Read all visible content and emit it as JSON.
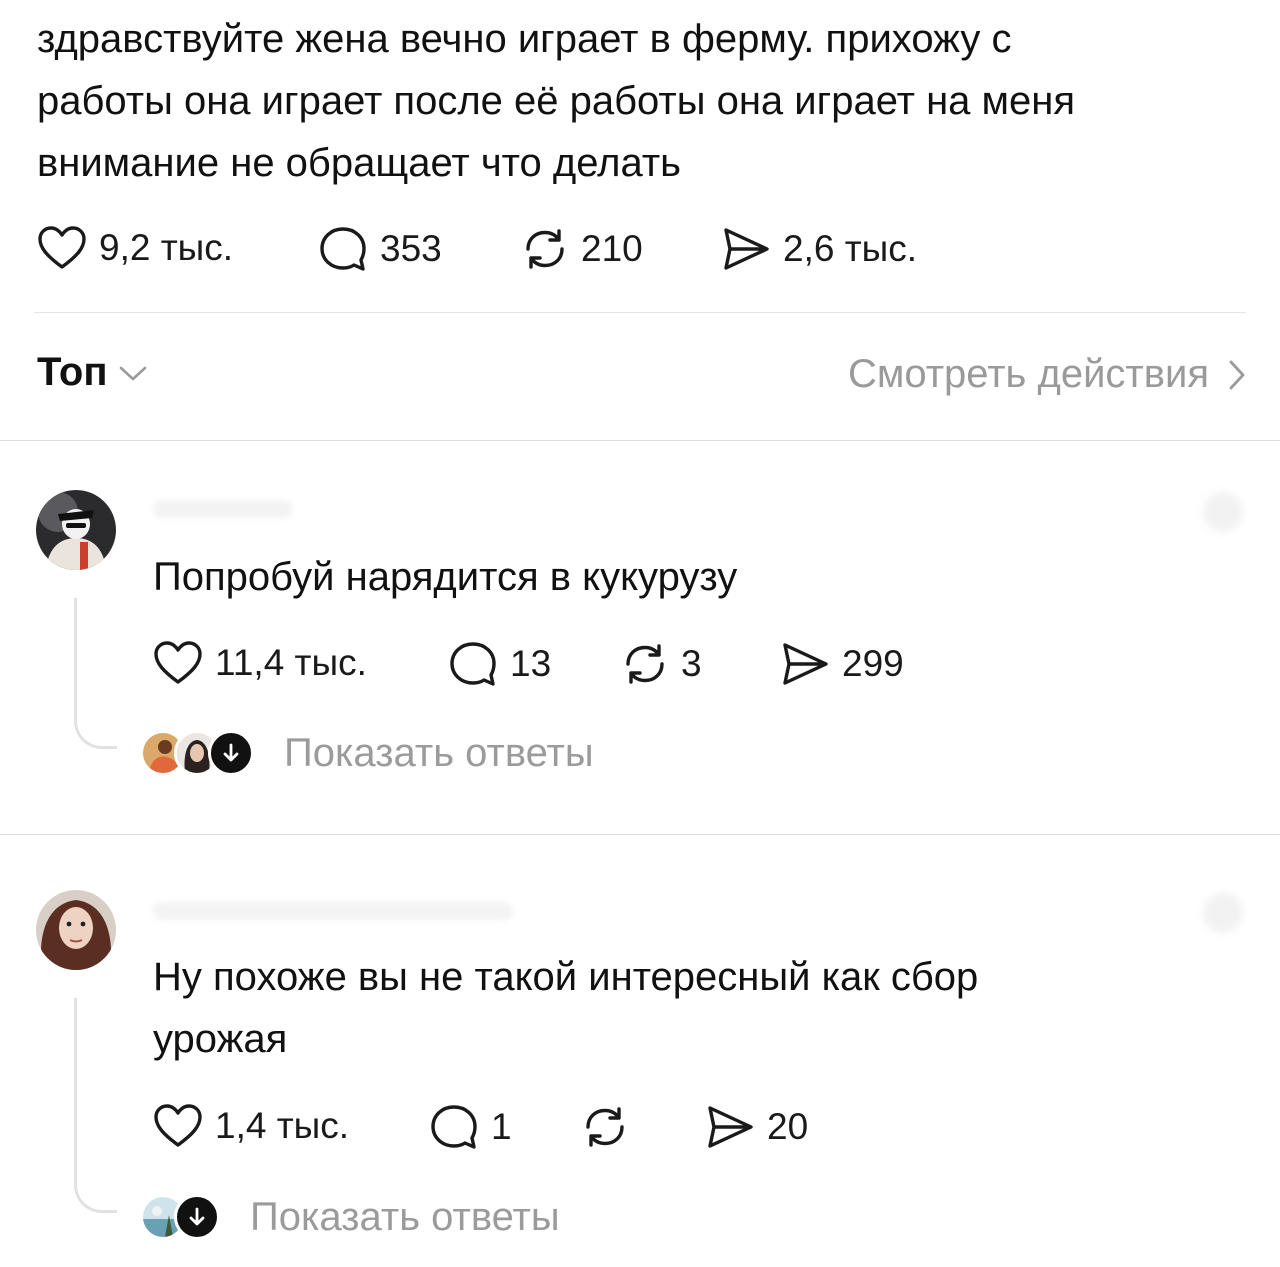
{
  "post": {
    "text_lines": [
      "здравствуйте жена вечно играет в ферму. прихожу с",
      "работы она играет после её работы она играет на меня",
      "внимание не обращает что делать"
    ],
    "stats": {
      "likes": "9,2 тыс.",
      "comments": "353",
      "reposts": "210",
      "shares": "2,6 тыс."
    }
  },
  "sort": {
    "label": "Топ",
    "activity_label": "Смотреть действия"
  },
  "comments": [
    {
      "text": "Попробуй нарядится в кукурузу",
      "stats": {
        "likes": "11,4 тыс.",
        "comments": "13",
        "reposts": "3",
        "shares": "299"
      },
      "show_replies_label": "Показать ответы"
    },
    {
      "text_lines": [
        "Ну похоже вы не такой интересный как сбор",
        "урожая"
      ],
      "stats": {
        "likes": "1,4 тыс.",
        "comments": "1",
        "reposts": "",
        "shares": "20"
      },
      "show_replies_label": "Показать ответы"
    }
  ],
  "icons": {
    "like": "heart-icon",
    "comment": "comment-bubble-icon",
    "repost": "repost-icon",
    "share": "send-icon",
    "chevron_down": "chevron-down-icon",
    "chevron_right": "chevron-right-icon",
    "reply_arrow": "arrow-down-icon"
  },
  "colors": {
    "text": "#111111",
    "muted": "#9a9a9a",
    "divider": "#dcdcdc",
    "background": "#ffffff"
  }
}
